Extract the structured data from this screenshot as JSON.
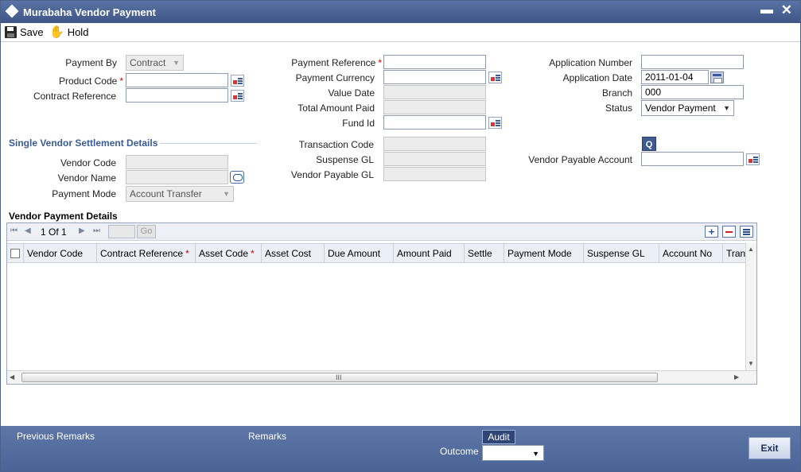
{
  "window": {
    "title": "Murabaha Vendor Payment",
    "minimize": "▬",
    "close": "✕"
  },
  "toolbar": {
    "save_label": "Save",
    "hold_label": "Hold"
  },
  "form": {
    "payment_by": {
      "label": "Payment By",
      "value": "Contract"
    },
    "product_code": {
      "label": "Product Code",
      "value": ""
    },
    "contract_reference": {
      "label": "Contract Reference",
      "value": ""
    },
    "payment_reference": {
      "label": "Payment Reference",
      "value": ""
    },
    "payment_currency": {
      "label": "Payment Currency",
      "value": ""
    },
    "value_date": {
      "label": "Value Date",
      "value": ""
    },
    "total_amount_paid": {
      "label": "Total Amount Paid",
      "value": ""
    },
    "fund_id": {
      "label": "Fund Id",
      "value": ""
    },
    "application_number": {
      "label": "Application Number",
      "value": ""
    },
    "application_date": {
      "label": "Application Date",
      "value": "2011-01-04"
    },
    "branch": {
      "label": "Branch",
      "value": "000"
    },
    "status": {
      "label": "Status",
      "value": "Vendor Payment"
    },
    "required_mark": "*"
  },
  "settlement": {
    "title": "Single Vendor Settlement Details",
    "vendor_code": {
      "label": "Vendor Code",
      "value": ""
    },
    "vendor_name": {
      "label": "Vendor Name",
      "value": ""
    },
    "payment_mode": {
      "label": "Payment Mode",
      "value": "Account Transfer"
    },
    "transaction_code": {
      "label": "Transaction Code",
      "value": ""
    },
    "suspense_gl": {
      "label": "Suspense GL",
      "value": ""
    },
    "vendor_payable_gl": {
      "label": "Vendor Payable GL",
      "value": ""
    },
    "query_button": "Q",
    "vendor_payable_account": {
      "label": "Vendor Payable Account",
      "value": ""
    }
  },
  "grid": {
    "title": "Vendor Payment Details",
    "page_info": "1 Of 1",
    "go_label": "Go",
    "add_label": "+",
    "columns": [
      "Vendor Code",
      "Contract Reference",
      "Asset Code",
      "Asset Cost",
      "Due Amount",
      "Amount Paid",
      "Settle",
      "Payment Mode",
      "Suspense GL",
      "Account No",
      "Tran"
    ],
    "scroll_grip": "III"
  },
  "footer": {
    "previous_remarks": "Previous Remarks",
    "remarks": "Remarks",
    "audit": "Audit",
    "outcome_label": "Outcome",
    "outcome_value": "",
    "exit": "Exit"
  }
}
